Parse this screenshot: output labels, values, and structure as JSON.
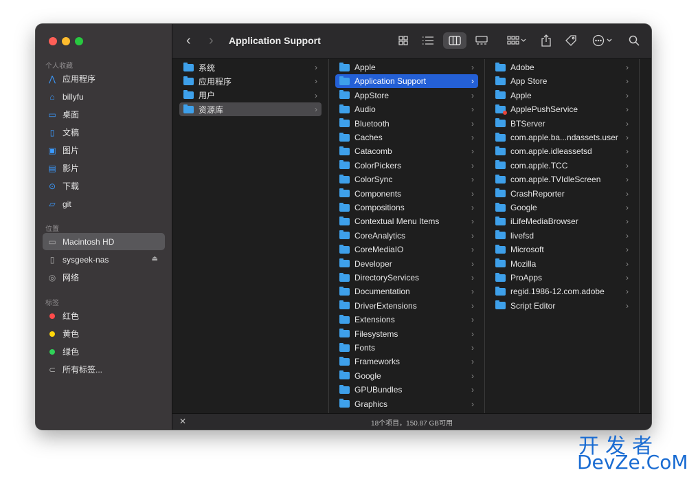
{
  "window": {
    "title": "Application Support"
  },
  "sidebar": {
    "favorites_label": "个人收藏",
    "favorites": [
      {
        "label": "应用程序",
        "icon": "apps-icon"
      },
      {
        "label": "billyfu",
        "icon": "home-icon"
      },
      {
        "label": "桌面",
        "icon": "desktop-icon"
      },
      {
        "label": "文稿",
        "icon": "document-icon"
      },
      {
        "label": "图片",
        "icon": "picture-icon"
      },
      {
        "label": "影片",
        "icon": "movie-icon"
      },
      {
        "label": "下载",
        "icon": "download-icon"
      },
      {
        "label": "git",
        "icon": "folder-icon"
      }
    ],
    "locations_label": "位置",
    "locations": [
      {
        "label": "Macintosh HD",
        "icon": "harddisk-icon"
      },
      {
        "label": "sysgeek-nas",
        "icon": "network-drive-icon"
      },
      {
        "label": "网络",
        "icon": "globe-icon"
      }
    ],
    "tags_label": "标签",
    "tags": [
      {
        "label": "红色",
        "color": "#ff4b4b"
      },
      {
        "label": "黄色",
        "color": "#ffd60a"
      },
      {
        "label": "绿色",
        "color": "#30d158"
      },
      {
        "label": "所有标签..."
      }
    ]
  },
  "columns": {
    "col1": [
      "系统",
      "应用程序",
      "用户",
      "资源库"
    ],
    "col1_selected": "资源库",
    "col2": [
      "Apple",
      "Application Support",
      "AppStore",
      "Audio",
      "Bluetooth",
      "Caches",
      "Catacomb",
      "ColorPickers",
      "ColorSync",
      "Components",
      "Compositions",
      "Contextual Menu Items",
      "CoreAnalytics",
      "CoreMediaIO",
      "Developer",
      "DirectoryServices",
      "Documentation",
      "DriverExtensions",
      "Extensions",
      "Filesystems",
      "Fonts",
      "Frameworks",
      "Google",
      "GPUBundles",
      "Graphics"
    ],
    "col2_selected": "Application Support",
    "col3": [
      "Adobe",
      "App Store",
      "Apple",
      "ApplePushService",
      "BTServer",
      "com.apple.ba...ndassets.user",
      "com.apple.idleassetsd",
      "com.apple.TCC",
      "com.apple.TVIdleScreen",
      "CrashReporter",
      "Google",
      "iLifeMediaBrowser",
      "livefsd",
      "Microsoft",
      "Mozilla",
      "ProApps",
      "regid.1986-12.com.adobe",
      "Script Editor"
    ]
  },
  "status": {
    "text": "18个项目，150.87 GB可用"
  },
  "watermark": {
    "line1": "开发者",
    "line2": "DevZe.CoM"
  },
  "colors": {
    "accent": "#2460d6",
    "folder": "#3ea0ea"
  }
}
